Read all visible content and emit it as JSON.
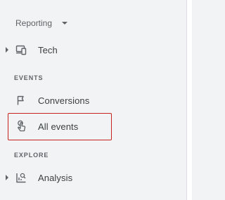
{
  "header": {
    "reporting_label": "Reporting"
  },
  "nav": {
    "tech": {
      "label": "Tech",
      "icon": "devices-icon"
    },
    "events_section": "EVENTS",
    "conversions": {
      "label": "Conversions",
      "icon": "flag-icon"
    },
    "all_events": {
      "label": "All events",
      "icon": "touch-icon"
    },
    "explore_section": "EXPLORE",
    "analysis": {
      "label": "Analysis",
      "icon": "analysis-icon"
    }
  },
  "colors": {
    "highlight": "#c5221f",
    "background": "#f1f3f4",
    "text": "#3c4043"
  }
}
